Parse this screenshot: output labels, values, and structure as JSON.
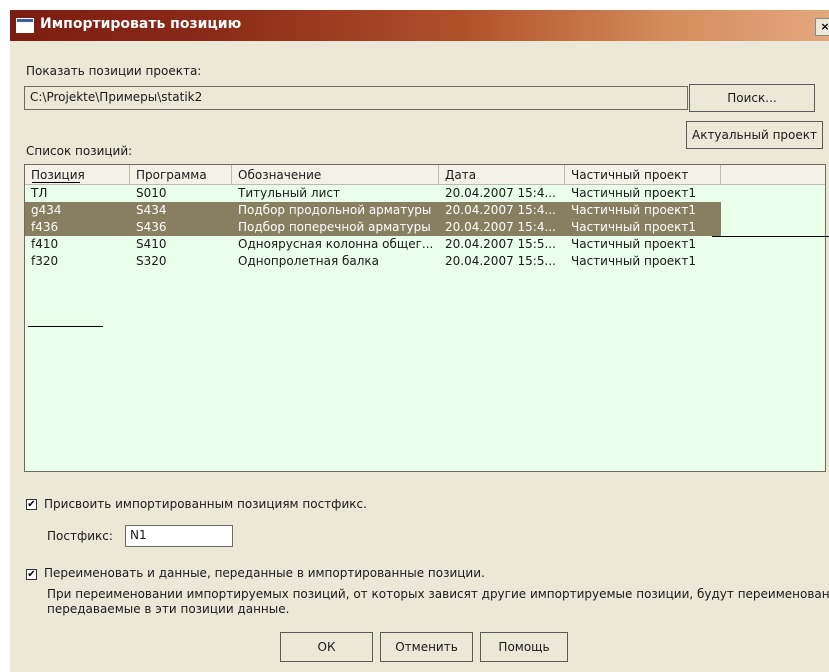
{
  "window": {
    "title": "Импортировать позицию",
    "close_glyph": "×"
  },
  "project": {
    "label": "Показать позиции проекта:",
    "path": "C:\\Projekte\\Примеры\\statik2",
    "search_button": "Поиск...",
    "current_project_button": "Актуальный проект"
  },
  "list": {
    "label": "Список позиций:",
    "columns": [
      "Позиция",
      "Программа",
      "Обозначение",
      "Дата",
      "Частичный проект"
    ],
    "rows": [
      {
        "pos": "ТЛ",
        "program": "S010",
        "name": "Титульный лист",
        "date": "20.04.2007 15:4...",
        "part": "Частичный проект1",
        "selected": false
      },
      {
        "pos": "g434",
        "program": "S434",
        "name": "Подбор продольной арматуры",
        "date": "20.04.2007 15:4...",
        "part": "Частичный проект1",
        "selected": true
      },
      {
        "pos": "f436",
        "program": "S436",
        "name": "Подбор поперечной арматуры",
        "date": "20.04.2007 15:4...",
        "part": "Частичный проект1",
        "selected": true
      },
      {
        "pos": "f410",
        "program": "S410",
        "name": "Одноярусная колонна общег...",
        "date": "20.04.2007 15:5...",
        "part": "Частичный проект1",
        "selected": false
      },
      {
        "pos": "f320",
        "program": "S320",
        "name": "Однопролетная балка",
        "date": "20.04.2007 15:5...",
        "part": "Частичный проект1",
        "selected": false
      }
    ]
  },
  "options": {
    "postfix_checkbox": "Присвоить импортированным позициям постфикс.",
    "postfix_checked": true,
    "postfix_label": "Постфикс:",
    "postfix_value": "N1",
    "rename_checkbox": "Переименовать и данные, переданные в импортированные позиции.",
    "rename_checked": true,
    "note_line1": "При переименовании импортируемых позиций, от которых зависят другие импортируемые позиции, будут переименованы и",
    "note_line2": "передаваемые в эти позиции данные.",
    "check_glyph": "✔"
  },
  "buttons": {
    "ok": "ОК",
    "cancel": "Отменить",
    "help": "Помощь"
  },
  "colors": {
    "title_gradient_start": "#7a1d10",
    "title_gradient_end": "#e3a77c",
    "dialog_bg": "#ece8d8",
    "list_bg": "#e9ffe9",
    "selection": "#877f60"
  }
}
